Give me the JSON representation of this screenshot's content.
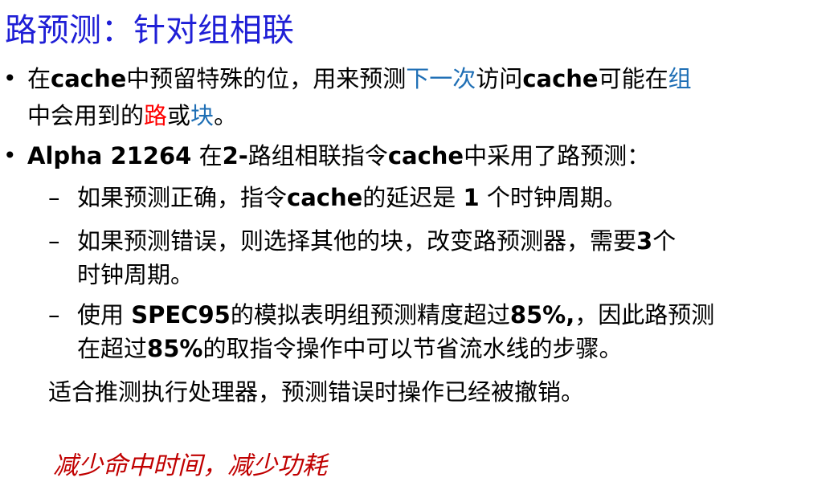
{
  "title": "路预测：针对组相联",
  "bullet1": {
    "line1": {
      "p1": "在",
      "p2": "cache",
      "p3": "中预留特殊的位，用来预测",
      "p4": "下一次",
      "p5": "访问",
      "p6": "cache",
      "p7": "可能在",
      "p8": "组"
    },
    "line2": {
      "p1": "中会用到的",
      "p2": "路",
      "p3": "或",
      "p4": "块",
      "p5": "。"
    }
  },
  "bullet2": {
    "p1": "Alpha 21264",
    "p2": " 在",
    "p3": "2-",
    "p4": "路组相联指令",
    "p5": "cache",
    "p6": "中采用了路预测："
  },
  "sub1": {
    "p1": "如果预测正确，指令",
    "p2": "cache",
    "p3": "的延迟是 ",
    "p4": "1",
    "p5": " 个时钟周期。"
  },
  "sub2": {
    "line1": {
      "p1": "如果预测错误，则选择其他的块，改变路预测器，需要",
      "p2": "3",
      "p3": "个"
    },
    "line2": "时钟周期。"
  },
  "sub3": {
    "line1": {
      "p1": "使用 ",
      "p2": "SPEC95",
      "p3": "的模拟表明组预测精度超过",
      "p4": "85%,",
      "p5": "，因此路预测"
    },
    "line2": {
      "p1": "在超过",
      "p2": "85%",
      "p3": "的取指令操作中可以节省流水线的步骤。"
    }
  },
  "note": "适合推测执行处理器，预测错误时操作已经被撤销。",
  "footer": "减少命中时间，减少功耗",
  "colors": {
    "title": "#1f1fd6",
    "highlight_blue": "#1f6fb5",
    "highlight_red": "#ff0000",
    "footer": "#c00000"
  }
}
